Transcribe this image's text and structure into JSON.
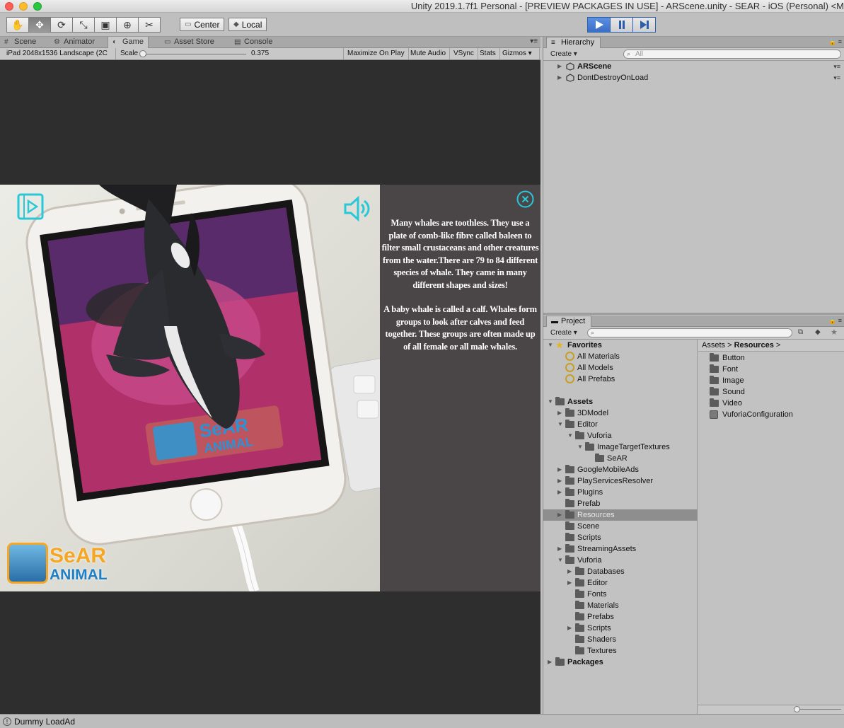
{
  "window": {
    "title": "Unity 2019.1.7f1 Personal - [PREVIEW PACKAGES IN USE] - ARScene.unity - SEAR - iOS (Personal) <M"
  },
  "toolbar": {
    "pivot_label": "Center",
    "space_label": "Local"
  },
  "left_tabs": [
    {
      "label": "Scene",
      "icon": "hash-icon"
    },
    {
      "label": "Animator",
      "icon": "animator-icon"
    },
    {
      "label": "Game",
      "icon": "pacman-icon"
    },
    {
      "label": "Asset Store",
      "icon": "cart-icon"
    },
    {
      "label": "Console",
      "icon": "console-icon"
    }
  ],
  "game_toolbar": {
    "resolution": "iPad 2048x1536 Landscape (2C",
    "scale_label": "Scale",
    "scale_value": "0.375",
    "maximize": "Maximize On Play",
    "mute": "Mute Audio",
    "vsync": "VSync",
    "stats": "Stats",
    "gizmos": "Gizmos"
  },
  "game_view": {
    "info_paragraphs": [
      "Many whales are toothless. They use a plate of comb-like fibre called baleen to filter small crustaceans and other creatures from the water.There are 79 to 84 different species of whale. They came in many different shapes and sizes!",
      "A baby whale is called a calf. Whales form groups to look after calves and feed together. These groups are often made up of all female or all male whales."
    ],
    "logo_line1": "SeAR",
    "logo_line2": "ANIMAL"
  },
  "hierarchy": {
    "tab_label": "Hierarchy",
    "create_label": "Create",
    "search_placeholder": "All",
    "items": [
      {
        "label": "ARScene",
        "bold": true
      },
      {
        "label": "DontDestroyOnLoad",
        "bold": false
      }
    ]
  },
  "project": {
    "tab_label": "Project",
    "create_label": "Create",
    "favorites_label": "Favorites",
    "favorites": [
      "All Materials",
      "All Models",
      "All Prefabs"
    ],
    "assets_label": "Assets",
    "tree": [
      {
        "label": "3DModel",
        "depth": 1,
        "arrow": "closed"
      },
      {
        "label": "Editor",
        "depth": 1,
        "arrow": "open"
      },
      {
        "label": "Vuforia",
        "depth": 2,
        "arrow": "open"
      },
      {
        "label": "ImageTargetTextures",
        "depth": 3,
        "arrow": "open"
      },
      {
        "label": "SeAR",
        "depth": 4,
        "arrow": "none"
      },
      {
        "label": "GoogleMobileAds",
        "depth": 1,
        "arrow": "closed"
      },
      {
        "label": "PlayServicesResolver",
        "depth": 1,
        "arrow": "closed"
      },
      {
        "label": "Plugins",
        "depth": 1,
        "arrow": "closed"
      },
      {
        "label": "Prefab",
        "depth": 1,
        "arrow": "none"
      },
      {
        "label": "Resources",
        "depth": 1,
        "arrow": "closed",
        "selected": true
      },
      {
        "label": "Scene",
        "depth": 1,
        "arrow": "none"
      },
      {
        "label": "Scripts",
        "depth": 1,
        "arrow": "none"
      },
      {
        "label": "StreamingAssets",
        "depth": 1,
        "arrow": "closed"
      },
      {
        "label": "Vuforia",
        "depth": 1,
        "arrow": "open"
      },
      {
        "label": "Databases",
        "depth": 2,
        "arrow": "closed"
      },
      {
        "label": "Editor",
        "depth": 2,
        "arrow": "closed"
      },
      {
        "label": "Fonts",
        "depth": 2,
        "arrow": "none"
      },
      {
        "label": "Materials",
        "depth": 2,
        "arrow": "none"
      },
      {
        "label": "Prefabs",
        "depth": 2,
        "arrow": "none"
      },
      {
        "label": "Scripts",
        "depth": 2,
        "arrow": "closed"
      },
      {
        "label": "Shaders",
        "depth": 2,
        "arrow": "none"
      },
      {
        "label": "Textures",
        "depth": 2,
        "arrow": "none"
      }
    ],
    "packages_label": "Packages",
    "breadcrumb_root": "Assets",
    "breadcrumb_current": "Resources",
    "contents": [
      {
        "label": "Button",
        "kind": "folder"
      },
      {
        "label": "Font",
        "kind": "folder"
      },
      {
        "label": "Image",
        "kind": "folder"
      },
      {
        "label": "Sound",
        "kind": "folder"
      },
      {
        "label": "Video",
        "kind": "folder"
      },
      {
        "label": "VuforiaConfiguration",
        "kind": "asset"
      }
    ]
  },
  "status": {
    "message": "Dummy LoadAd"
  },
  "colors": {
    "play_blue": "#3a6fc7",
    "accent_cyan": "#28c8d8",
    "info_panel_bg": "#4a4546",
    "logo_orange": "#f5a623"
  }
}
